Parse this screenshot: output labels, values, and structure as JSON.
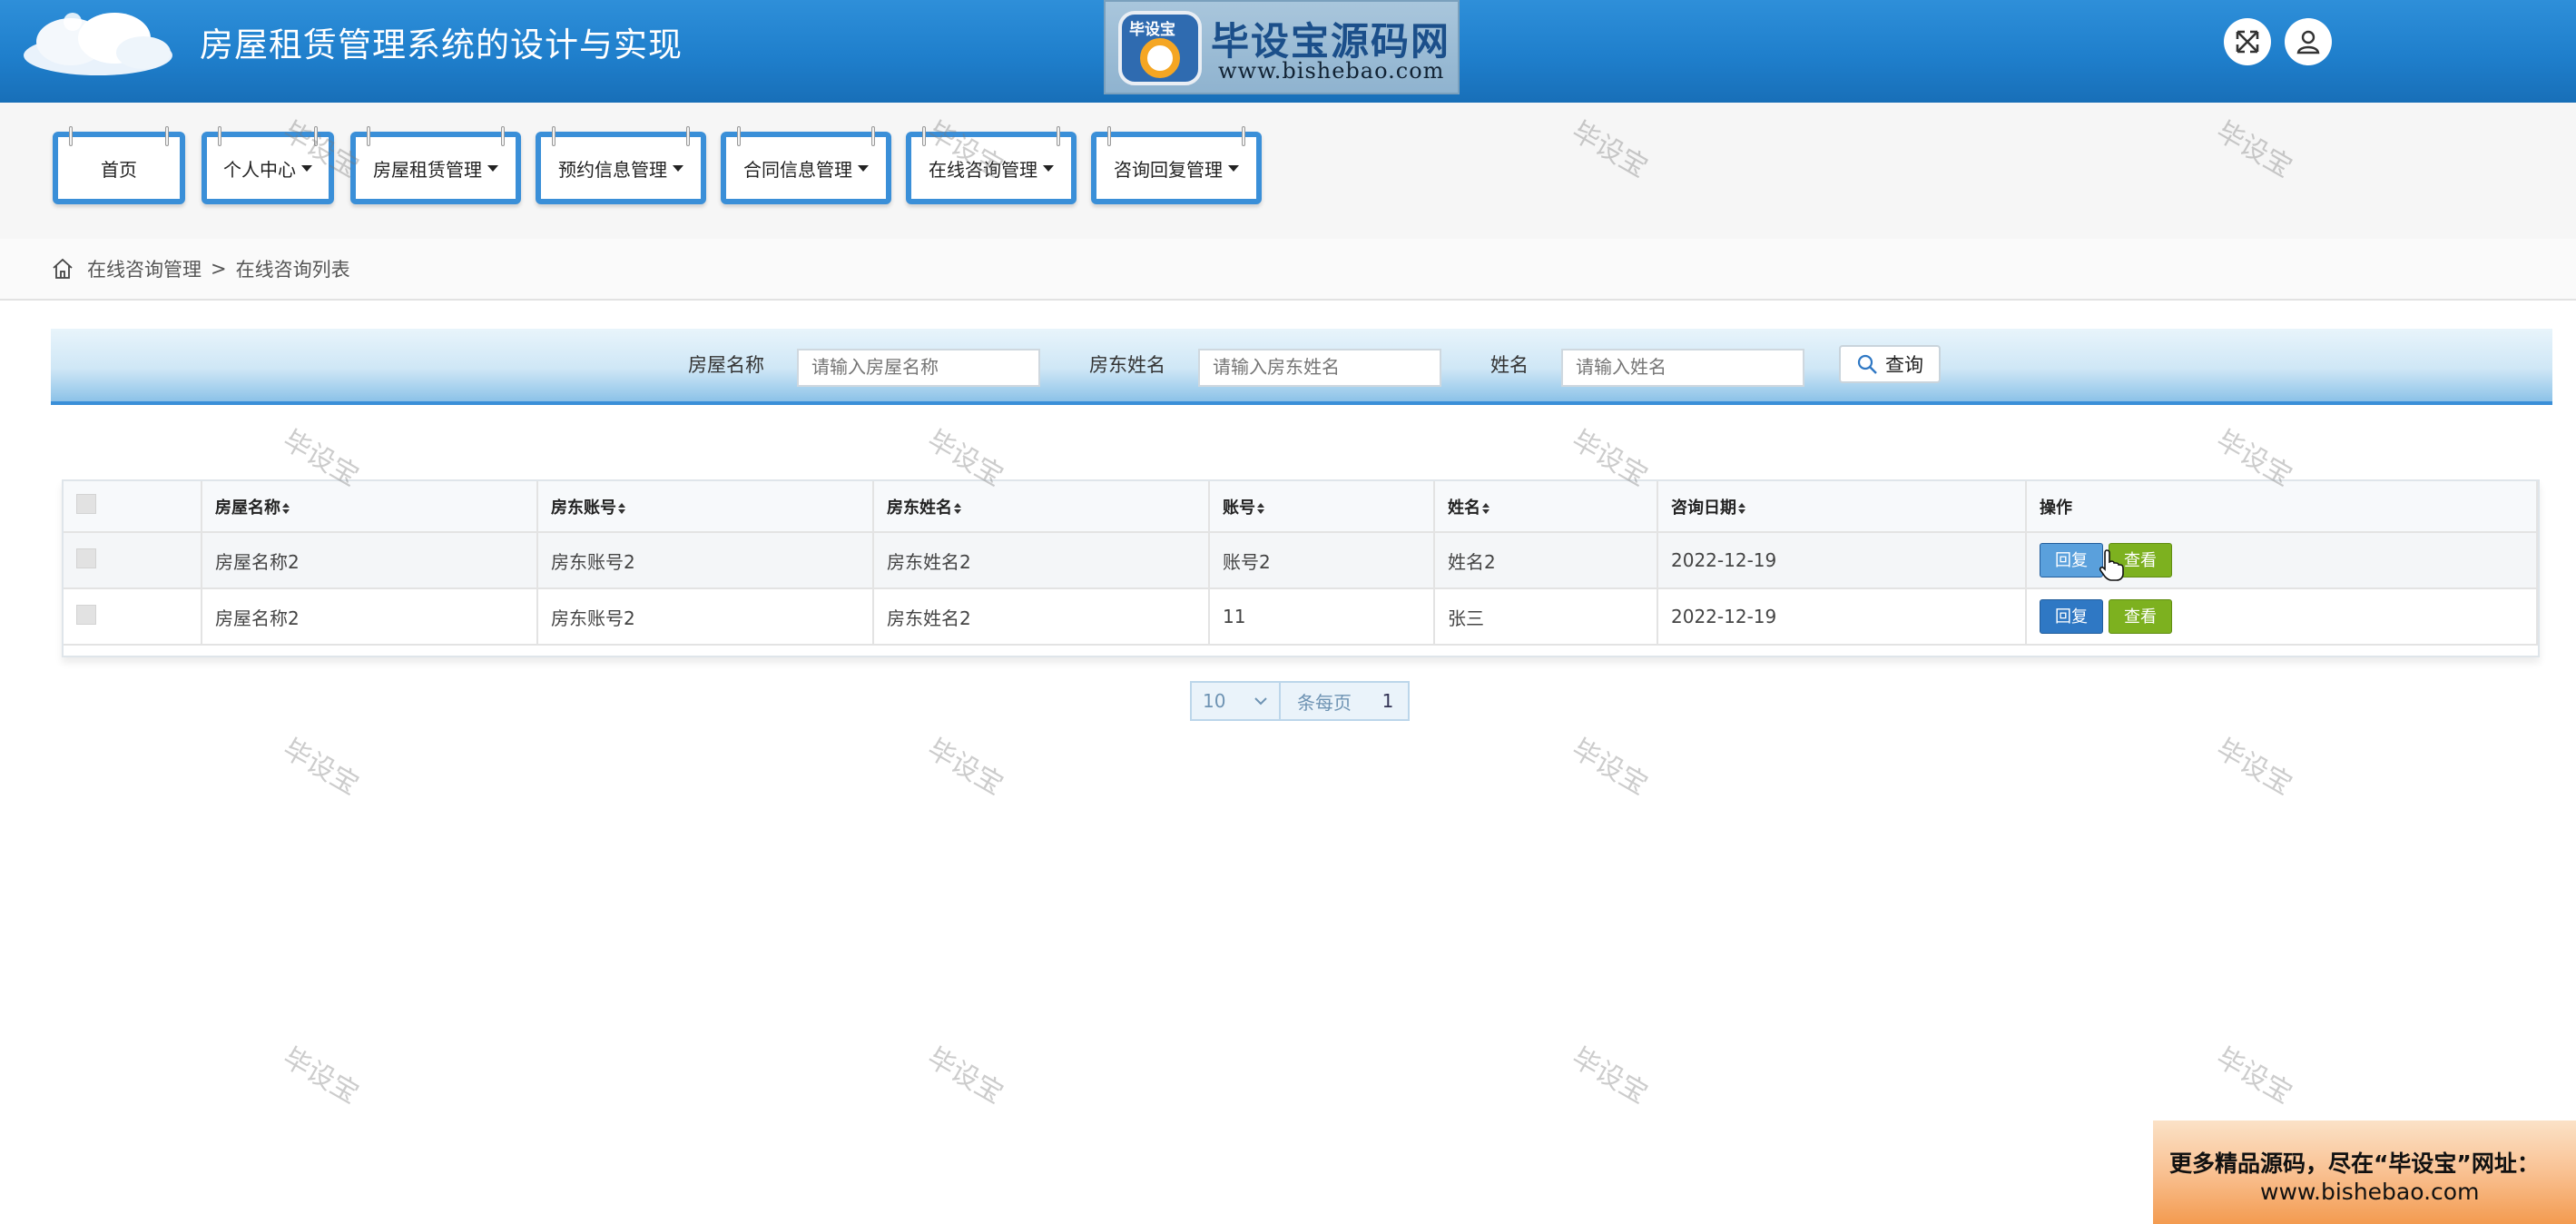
{
  "header": {
    "title": "房屋租赁管理系统的设计与实现",
    "logo_text": "毕设宝源码网",
    "logo_url": "www.bishebao.com",
    "logo_badge": "毕设宝",
    "icons": [
      "fullscreen-icon",
      "user-icon"
    ]
  },
  "nav": {
    "items": [
      {
        "label": "首页",
        "has_dropdown": false
      },
      {
        "label": "个人中心",
        "has_dropdown": true
      },
      {
        "label": "房屋租赁管理",
        "has_dropdown": true
      },
      {
        "label": "预约信息管理",
        "has_dropdown": true
      },
      {
        "label": "合同信息管理",
        "has_dropdown": true
      },
      {
        "label": "在线咨询管理",
        "has_dropdown": true
      },
      {
        "label": "咨询回复管理",
        "has_dropdown": true
      }
    ]
  },
  "breadcrumb": {
    "items": [
      "在线咨询管理",
      "在线咨询列表"
    ],
    "separator": ">"
  },
  "search": {
    "fields": [
      {
        "label": "房屋名称",
        "placeholder": "请输入房屋名称",
        "value": ""
      },
      {
        "label": "房东姓名",
        "placeholder": "请输入房东姓名",
        "value": ""
      },
      {
        "label": "姓名",
        "placeholder": "请输入姓名",
        "value": ""
      }
    ],
    "button_label": "查询"
  },
  "table": {
    "columns": [
      "",
      "房屋名称",
      "房东账号",
      "房东姓名",
      "账号",
      "姓名",
      "咨询日期",
      "操作"
    ],
    "rows": [
      {
        "house_name": "房屋名称2",
        "landlord_account": "房东账号2",
        "landlord_name": "房东姓名2",
        "account": "账号2",
        "name": "姓名2",
        "date": "2022-12-19"
      },
      {
        "house_name": "房屋名称2",
        "landlord_account": "房东账号2",
        "landlord_name": "房东姓名2",
        "account": "11",
        "name": "张三",
        "date": "2022-12-19"
      }
    ],
    "actions": {
      "reply": "回复",
      "view": "查看"
    }
  },
  "pagination": {
    "page_size": "10",
    "per_page_label": "条每页",
    "current_page": "1"
  },
  "watermark": "毕设宝",
  "ad": {
    "line1": "更多精品源码，尽在“毕设宝”网址：",
    "line2": "www.bishebao.com"
  },
  "colors": {
    "header_blue": "#1f7fcc",
    "nav_border": "#3a8fd8",
    "reply_button": "#2f78c4",
    "view_button": "#7db11f"
  }
}
